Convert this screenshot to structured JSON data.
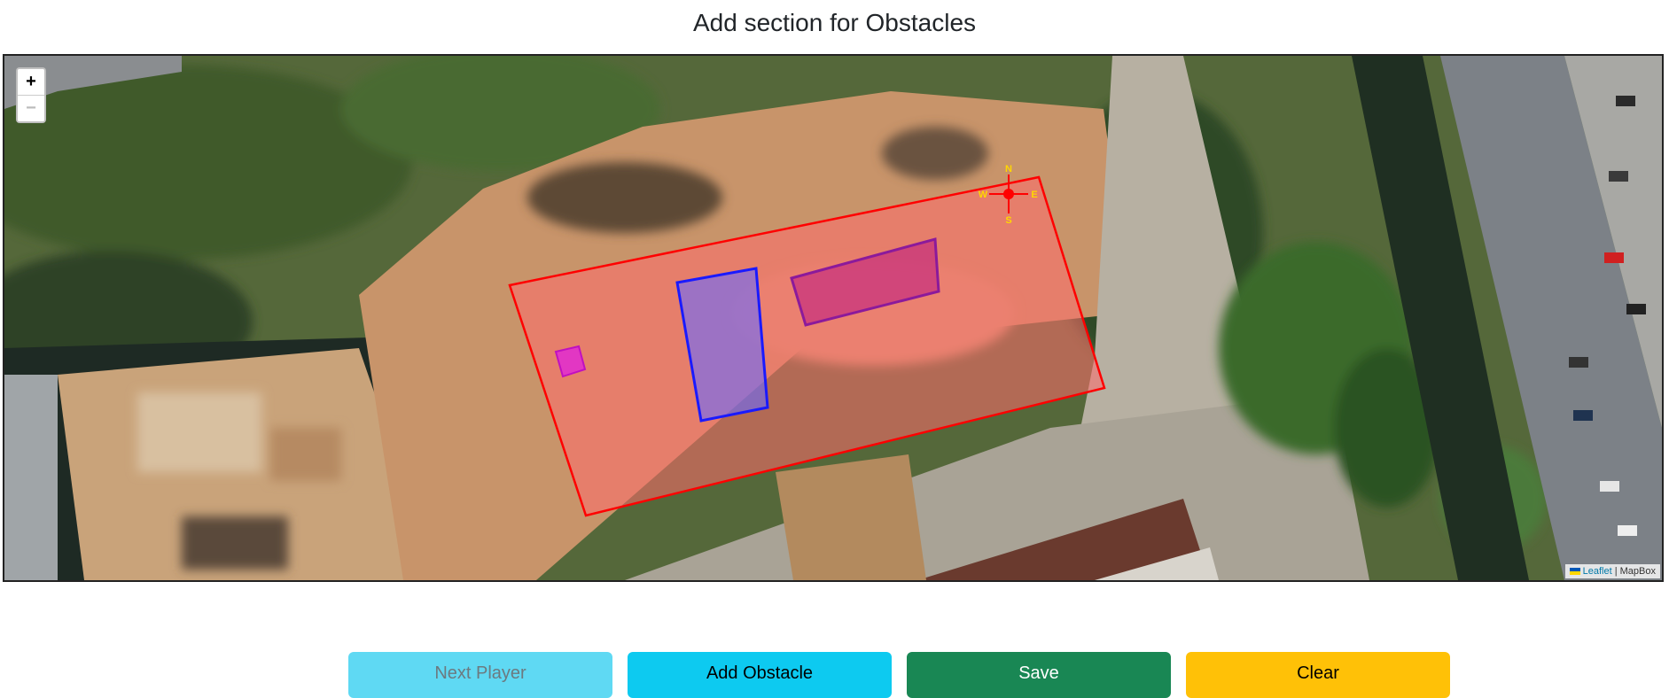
{
  "page": {
    "title": "Add section for Obstacles"
  },
  "map": {
    "zoom_in_label": "+",
    "zoom_out_label": "−",
    "attribution_link": "Leaflet",
    "attribution_separator": " | ",
    "attribution_source": "MapBox",
    "compass": {
      "north": "N",
      "south": "S",
      "east": "E",
      "west": "W"
    },
    "colors": {
      "field_outline": "#ff0000",
      "field_fill": "#ff6b6b",
      "obstacle_blue": "#1a1aff",
      "obstacle_purple": "#8b1a9b",
      "obstacle_magenta": "#e020e0",
      "compass": "#ff0000",
      "compass_labels": "#ffd700"
    }
  },
  "buttons": {
    "next_player": "Next Player",
    "add_obstacle": "Add Obstacle",
    "save": "Save",
    "clear": "Clear"
  }
}
